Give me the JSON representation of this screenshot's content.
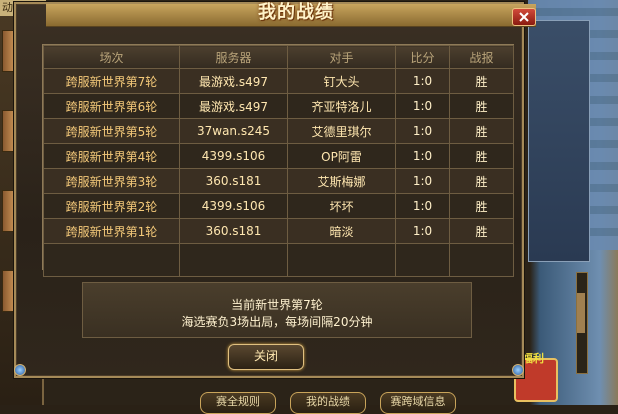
{
  "background": {
    "left_list_title": "动列表",
    "bottom_buttons": [
      "赛全规则",
      "我的战绩",
      "赛跨域信息"
    ],
    "gift_label": "福利"
  },
  "dialog": {
    "title": "我的战绩",
    "close_icon": "close-icon",
    "columns": [
      "场次",
      "服务器",
      "对手",
      "比分",
      "战报"
    ],
    "rows": [
      {
        "round": "跨服新世界第7轮",
        "server": "最游戏.s497",
        "opponent": "钉大头",
        "score": "1:0",
        "result": "胜"
      },
      {
        "round": "跨服新世界第6轮",
        "server": "最游戏.s497",
        "opponent": "齐亚特洛儿",
        "score": "1:0",
        "result": "胜"
      },
      {
        "round": "跨服新世界第5轮",
        "server": "37wan.s245",
        "opponent": "艾德里琪尔",
        "score": "1:0",
        "result": "胜"
      },
      {
        "round": "跨服新世界第4轮",
        "server": "4399.s106",
        "opponent": "OP阿雷",
        "score": "1:0",
        "result": "胜"
      },
      {
        "round": "跨服新世界第3轮",
        "server": "360.s181",
        "opponent": "艾斯梅娜",
        "score": "1:0",
        "result": "胜"
      },
      {
        "round": "跨服新世界第2轮",
        "server": "4399.s106",
        "opponent": "坏坏",
        "score": "1:0",
        "result": "胜"
      },
      {
        "round": "跨服新世界第1轮",
        "server": "360.s181",
        "opponent": "暗淡",
        "score": "1:0",
        "result": "胜"
      }
    ],
    "info": {
      "line1": "当前新世界第7轮",
      "line2": "海选赛负3场出局，每场间隔20分钟"
    },
    "close_button_label": "关闭"
  }
}
